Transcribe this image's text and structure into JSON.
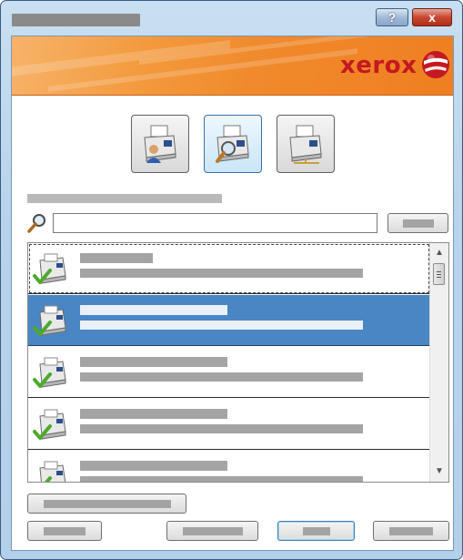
{
  "window": {
    "title": "",
    "help_label": "?",
    "close_label": "x"
  },
  "banner": {
    "brand": "xerox"
  },
  "modes": [
    {
      "icon": "printer-user-icon",
      "state": "normal"
    },
    {
      "icon": "printer-search-icon",
      "state": "active"
    },
    {
      "icon": "printer-network-icon",
      "state": "normal"
    }
  ],
  "search": {
    "value": "",
    "placeholder": "",
    "button_label": ""
  },
  "devices": [
    {
      "title": "",
      "subtitle": "",
      "selected": false,
      "focused": true,
      "status": "ok"
    },
    {
      "title": "",
      "subtitle": "",
      "selected": true,
      "focused": false,
      "status": "ok"
    },
    {
      "title": "",
      "subtitle": "",
      "selected": false,
      "focused": false,
      "status": "ok"
    },
    {
      "title": "",
      "subtitle": "",
      "selected": false,
      "focused": false,
      "status": "ok"
    },
    {
      "title": "",
      "subtitle": "",
      "selected": false,
      "focused": false,
      "status": "ok"
    }
  ],
  "buttons": {
    "wide_label": "",
    "b1_label": "",
    "b2_label": "",
    "b3_label": "",
    "b4_label": ""
  },
  "colors": {
    "banner": "#f08a2c",
    "brand_red": "#c41920",
    "selection": "#4a86c4",
    "check": "#4caa2c"
  }
}
